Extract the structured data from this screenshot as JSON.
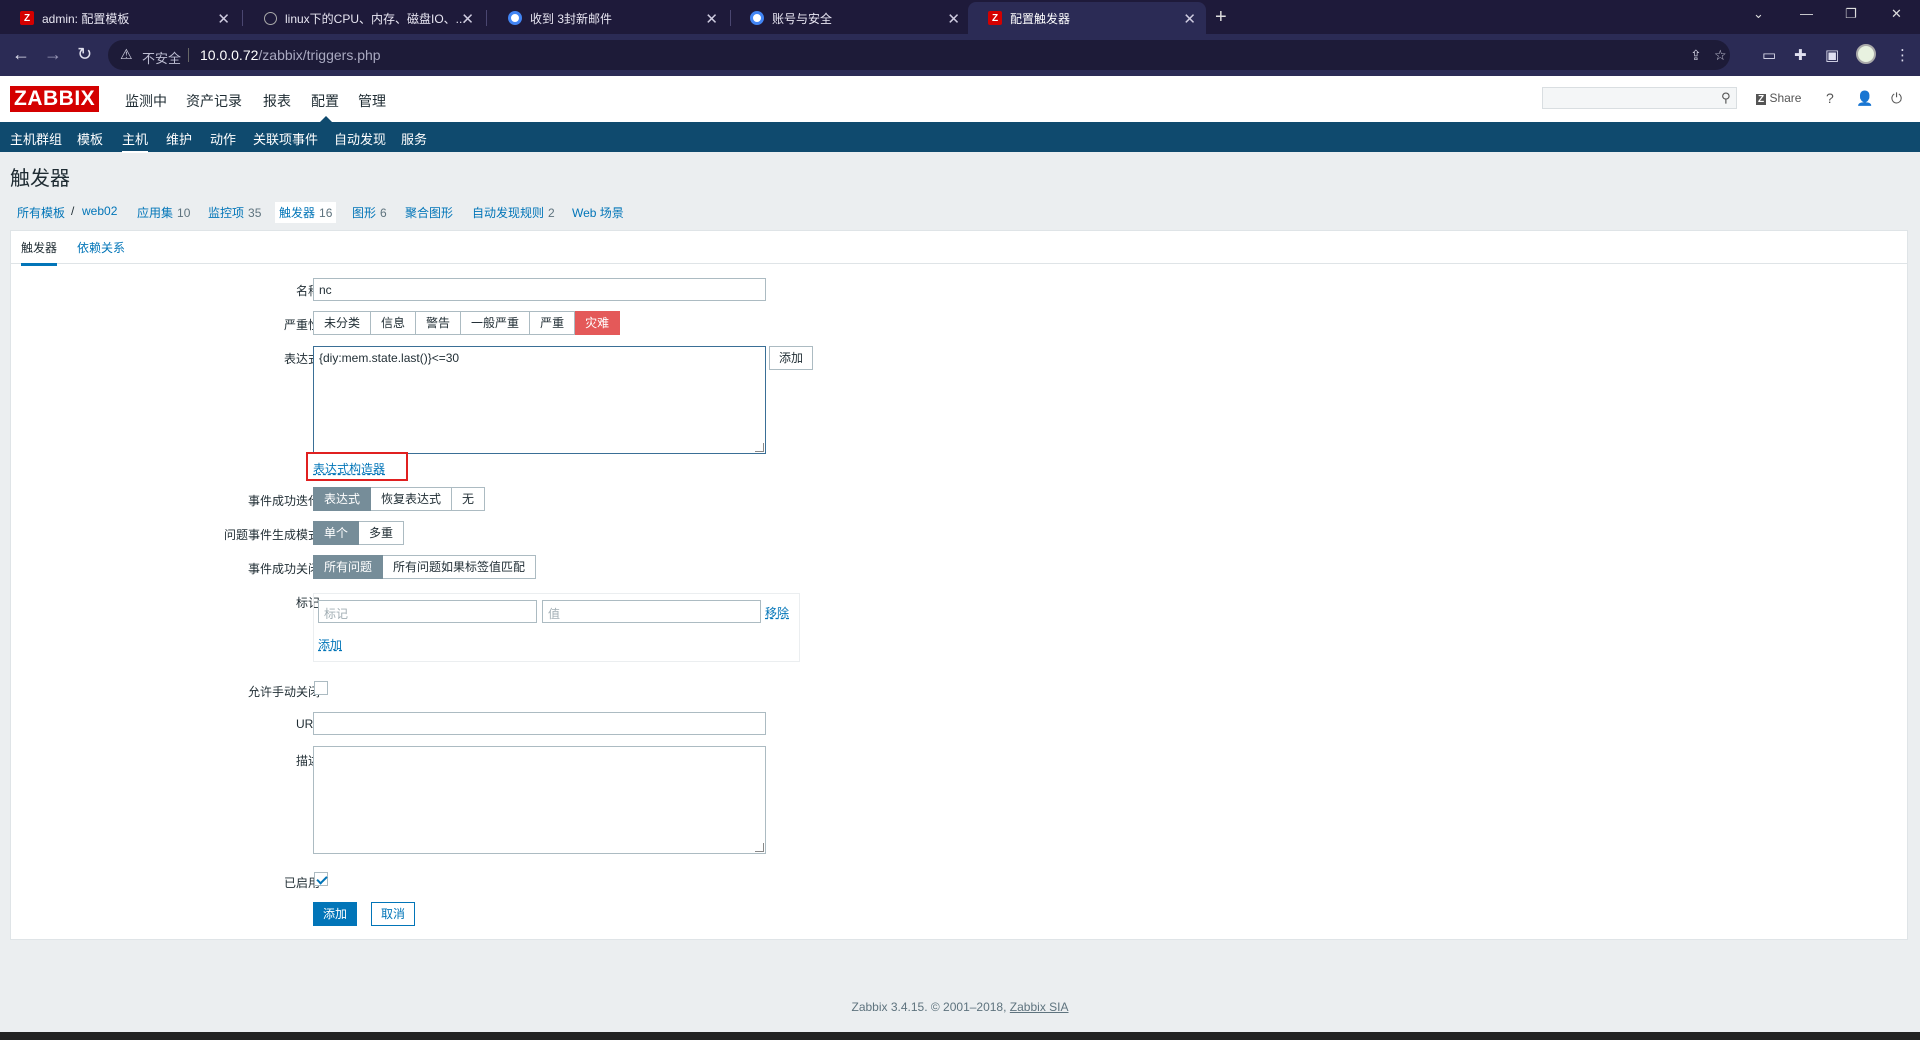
{
  "browser": {
    "tabs": [
      {
        "title": "admin: 配置模板"
      },
      {
        "title": "linux下的CPU、内存、磁盘IO、..."
      },
      {
        "title": "收到 3封新邮件"
      },
      {
        "title": "账号与安全"
      },
      {
        "title": "配置触发器"
      }
    ],
    "address": {
      "security_label": "不安全",
      "host": "10.0.0.72",
      "path": "/zabbix/triggers.php"
    }
  },
  "zabbix": {
    "logo": "ZABBIX",
    "top_menu": [
      "监测中",
      "资产记录",
      "报表",
      "配置",
      "管理"
    ],
    "share_label": "Share",
    "help_label": "?",
    "sub_menu": [
      "主机群组",
      "模板",
      "主机",
      "维护",
      "动作",
      "关联项事件",
      "自动发现",
      "服务"
    ]
  },
  "page": {
    "title": "触发器",
    "breadcrumbs": [
      {
        "label": "所有模板",
        "count": ""
      },
      {
        "label": "web02",
        "count": ""
      },
      {
        "label": "应用集",
        "count": "10"
      },
      {
        "label": "监控项",
        "count": "35"
      },
      {
        "label": "触发器",
        "count": "16"
      },
      {
        "label": "图形",
        "count": "6"
      },
      {
        "label": "聚合图形",
        "count": ""
      },
      {
        "label": "自动发现规则",
        "count": "2"
      },
      {
        "label": "Web 场景",
        "count": ""
      }
    ],
    "breadcrumb_separator": "/",
    "form_tabs": [
      "触发器",
      "依赖关系"
    ]
  },
  "form": {
    "name": {
      "label": "名称",
      "value": "nc"
    },
    "severity": {
      "label": "严重性",
      "options": [
        "未分类",
        "信息",
        "警告",
        "一般严重",
        "严重",
        "灾难"
      ],
      "selected": "灾难"
    },
    "expression": {
      "label": "表达式",
      "value": "{diy:mem.state.last()}<=30",
      "add_button": "添加",
      "builder_link": "表达式构造器"
    },
    "ok_event_generation": {
      "label": "事件成功迭代",
      "options": [
        "表达式",
        "恢复表达式",
        "无"
      ],
      "selected": "表达式"
    },
    "problem_event_mode": {
      "label": "问题事件生成模式",
      "options": [
        "单个",
        "多重"
      ],
      "selected": "单个"
    },
    "ok_event_closes": {
      "label": "事件成功关闭",
      "options": [
        "所有问题",
        "所有问题如果标签值匹配"
      ],
      "selected": "所有问题"
    },
    "tags": {
      "label": "标记",
      "tag_placeholder": "标记",
      "value_placeholder": "值",
      "remove_link": "移除",
      "add_link": "添加"
    },
    "manual_close": {
      "label": "允许手动关闭",
      "checked": false
    },
    "url": {
      "label": "URL",
      "value": ""
    },
    "description": {
      "label": "描述",
      "value": ""
    },
    "enabled": {
      "label": "已启用",
      "checked": true
    },
    "submit_label": "添加",
    "cancel_label": "取消"
  },
  "footer": {
    "text": "Zabbix 3.4.15. © 2001–2018,",
    "company": "Zabbix SIA"
  }
}
